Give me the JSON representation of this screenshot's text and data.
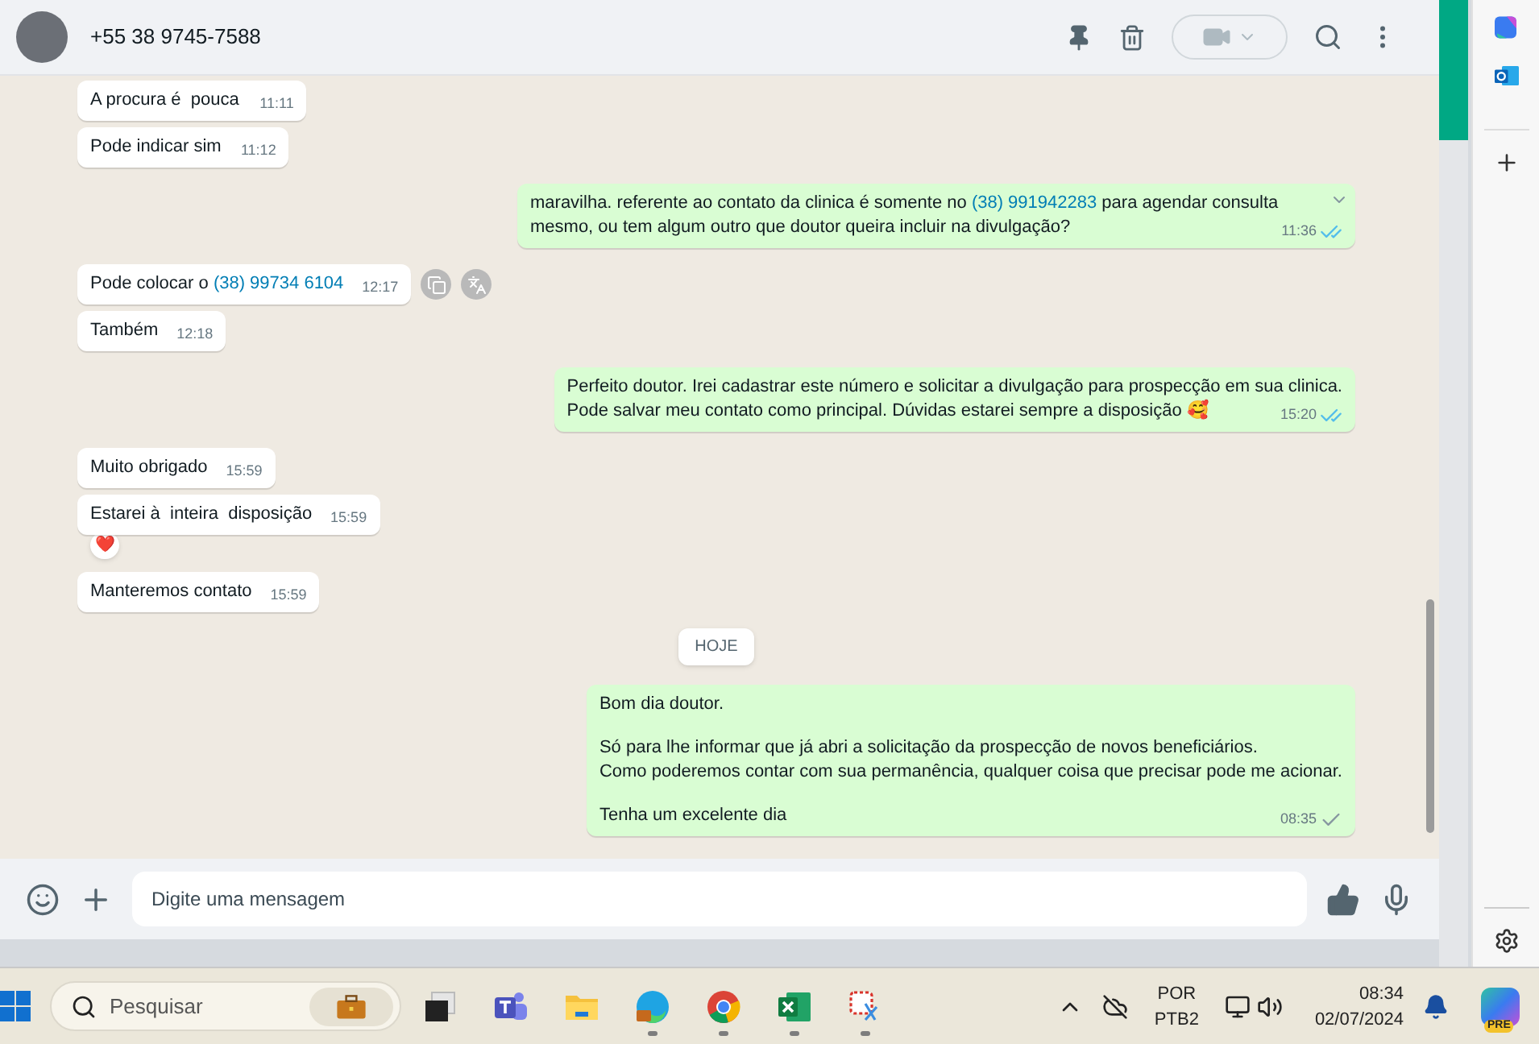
{
  "header": {
    "contact": "+55 38 9745-7588"
  },
  "messages": [
    {
      "kind": "incoming",
      "text": "A procura é  pouca",
      "time": "11:11"
    },
    {
      "kind": "incoming",
      "text": "Pode indicar sim",
      "time": "11:12"
    },
    {
      "kind": "outgoing",
      "text": "maravilha. referente ao contato da clinica é somente no ",
      "link": "(38) 991942283",
      "text_after": " para agendar consulta mesmo, ou tem algum outro que doutor queira incluir na divulgação?",
      "time": "11:36",
      "read": true,
      "hovered": true
    },
    {
      "kind": "incoming",
      "text": "Pode colocar o ",
      "link": "(38) 99734 6104",
      "time": "12:17",
      "hovered": true
    },
    {
      "kind": "incoming",
      "text": "Também",
      "time": "12:18"
    },
    {
      "kind": "outgoing",
      "paragraphs": [
        [
          "Perfeito doutor. Irei cadastrar este número e solicitar a divulgação para prospecção em sua clinica.",
          "Pode salvar meu contato como principal. Dúvidas estarei sempre a disposição 🥰"
        ]
      ],
      "time": "15:20",
      "read": true,
      "hovered": false
    },
    {
      "kind": "incoming",
      "text": "Muito obrigado",
      "time": "15:59"
    },
    {
      "kind": "incoming",
      "text": "Estarei à  inteira  disposição",
      "time": "15:59",
      "reaction": "❤️"
    },
    {
      "kind": "incoming",
      "text": "Manteremos contato",
      "time": "15:59"
    },
    {
      "kind": "date",
      "text": "HOJE"
    },
    {
      "kind": "outgoing",
      "paragraphs": [
        [
          "Bom dia doutor."
        ],
        [
          "Só para lhe informar que já abri a solicitação da prospecção de novos beneficiários.",
          "Como poderemos contar com sua permanência, qualquer coisa que precisar pode me acionar."
        ],
        [
          "Tenha um excelente dia"
        ]
      ],
      "time": "08:35",
      "read": false,
      "hovered": false
    }
  ],
  "composer": {
    "placeholder": "Digite uma mensagem"
  },
  "taskbar": {
    "search_placeholder": "Pesquisar",
    "apps": [
      {
        "kind": "task-view",
        "running": false
      },
      {
        "kind": "teams",
        "running": false
      },
      {
        "kind": "folder",
        "running": false
      },
      {
        "kind": "edge",
        "running": true
      },
      {
        "kind": "chrome",
        "running": true
      },
      {
        "kind": "excel",
        "running": true
      },
      {
        "kind": "snip",
        "running": true
      }
    ],
    "language": "POR",
    "layout": "PTB2",
    "time": "08:34",
    "date": "02/07/2024",
    "copilot_badge": "PRE"
  }
}
